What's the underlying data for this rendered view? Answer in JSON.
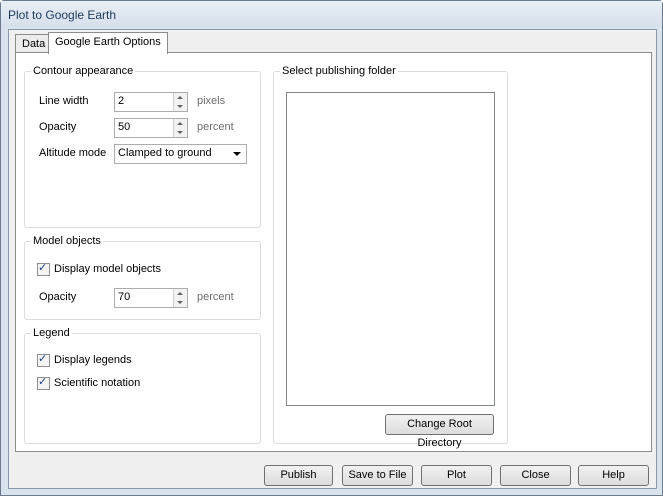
{
  "window": {
    "title": "Plot to Google Earth"
  },
  "tabs": [
    {
      "label": "Data"
    },
    {
      "label": "Google Earth Options"
    }
  ],
  "contour": {
    "title": "Contour appearance",
    "line_width_label": "Line width",
    "line_width_value": "2",
    "line_width_unit": "pixels",
    "opacity_label": "Opacity",
    "opacity_value": "50",
    "opacity_unit": "percent",
    "altitude_label": "Altitude mode",
    "altitude_value": "Clamped to ground"
  },
  "model": {
    "title": "Model objects",
    "display_label": "Display model objects",
    "display_checked": true,
    "opacity_label": "Opacity",
    "opacity_value": "70",
    "opacity_unit": "percent"
  },
  "legend": {
    "title": "Legend",
    "display_legends_label": "Display legends",
    "display_legends_checked": true,
    "scientific_label": "Scientific notation",
    "scientific_checked": true
  },
  "folder": {
    "title": "Select publishing folder",
    "change_root_label": "Change Root Directory"
  },
  "buttons": {
    "publish": "Publish",
    "save": "Save to File",
    "plot": "Plot",
    "close": "Close",
    "help": "Help"
  },
  "icons": {
    "check": "check-icon",
    "spin_up": "spin-up-icon",
    "spin_down": "spin-down-icon",
    "dropdown": "dropdown-arrow-icon"
  }
}
